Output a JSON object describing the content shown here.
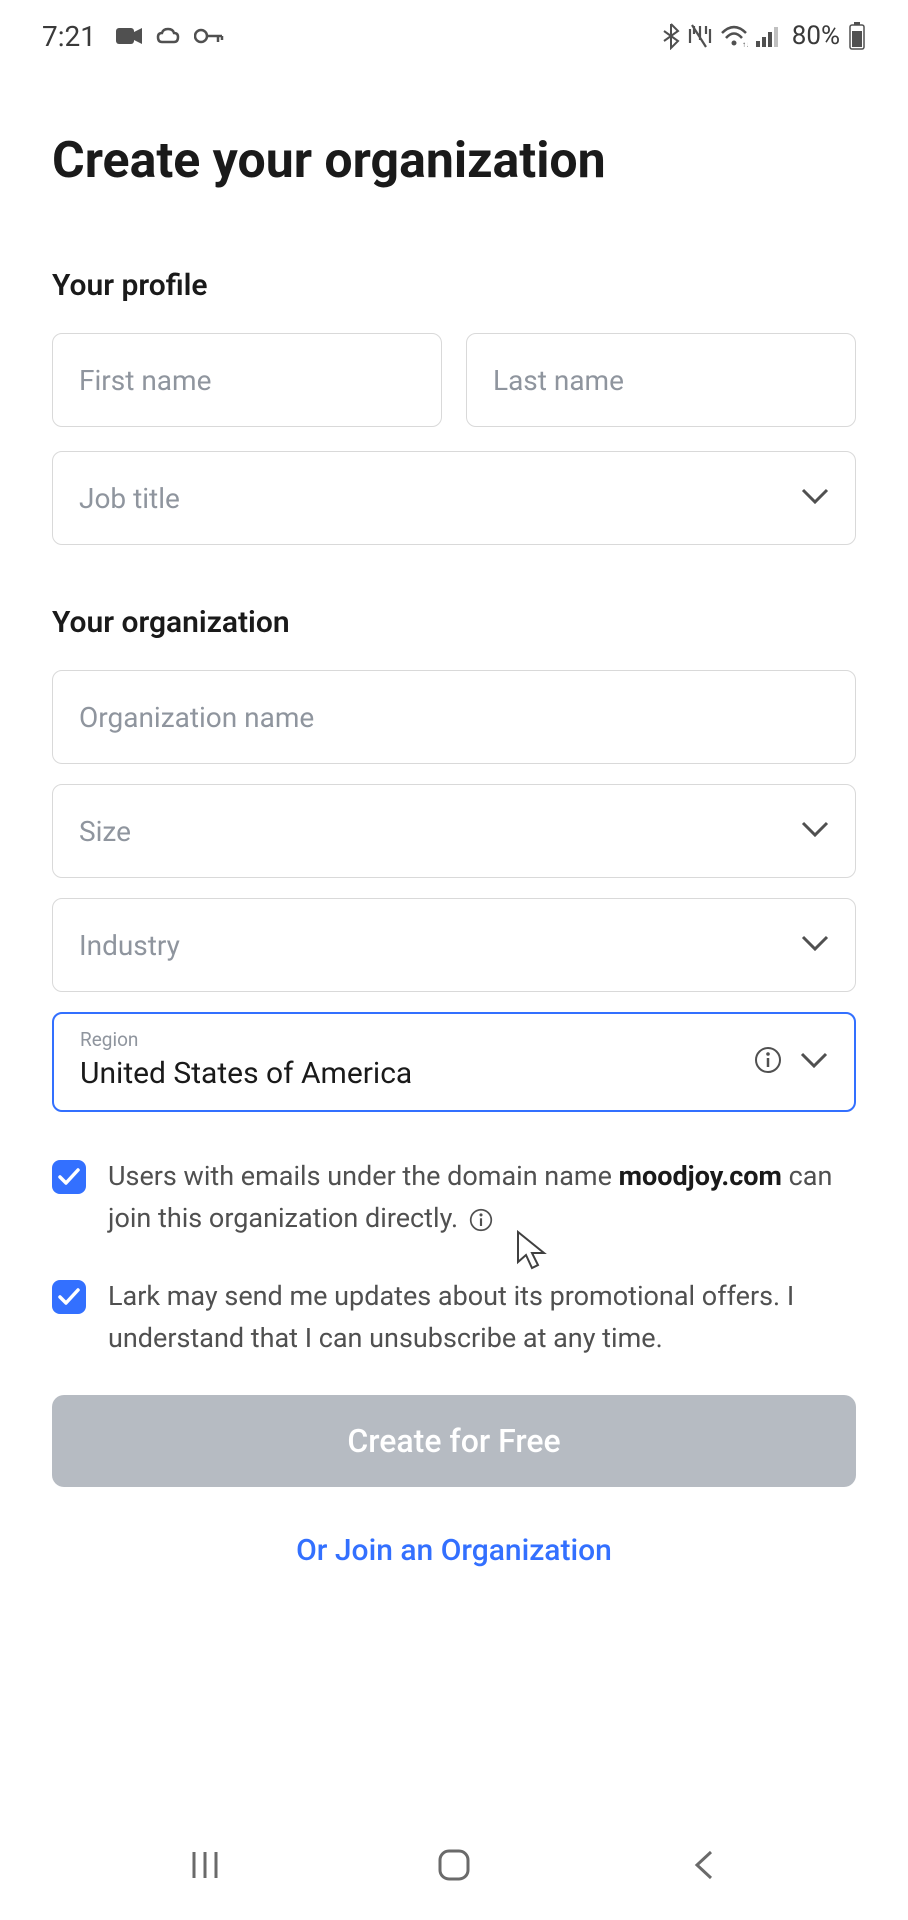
{
  "status_bar": {
    "time": "7:21",
    "battery_percent": "80%"
  },
  "page": {
    "title": "Create your organization"
  },
  "profile": {
    "heading": "Your profile",
    "first_name_placeholder": "First name",
    "last_name_placeholder": "Last name",
    "job_title_placeholder": "Job title"
  },
  "organization": {
    "heading": "Your organization",
    "name_placeholder": "Organization name",
    "size_placeholder": "Size",
    "industry_placeholder": "Industry",
    "region_label": "Region",
    "region_value": "United States of America"
  },
  "checkboxes": {
    "domain_prefix": "Users with emails under the domain name ",
    "domain_name": "moodjoy.com",
    "domain_suffix": " can join this organization directly.",
    "promo_text": "Lark may send me updates about its promotional offers. I understand that I can unsubscribe at any time."
  },
  "actions": {
    "primary_button": "Create for Free",
    "link": "Or Join an Organization"
  }
}
